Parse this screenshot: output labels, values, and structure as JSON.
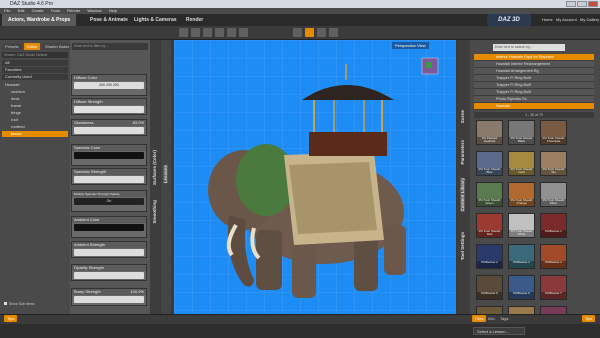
{
  "window": {
    "title": "DAZ Studio 4.6 Pro"
  },
  "menu": [
    "File",
    "Edit",
    "Create",
    "Tools",
    "Render",
    "Window",
    "Help"
  ],
  "main_tabs": [
    {
      "label": "Actors, Wardrobe & Props",
      "active": true
    },
    {
      "label": "Pose & Animate",
      "active": false
    },
    {
      "label": "Lights & Cameras",
      "active": false
    },
    {
      "label": "Render",
      "active": false
    }
  ],
  "brand": {
    "logo": "DAZ 3D"
  },
  "account_links": [
    "Home",
    "My Account",
    "My Gallery"
  ],
  "left_panel": {
    "tabs": [
      {
        "label": "Presets",
        "active": false
      },
      {
        "label": "Editor",
        "active": true
      },
      {
        "label": "Shader Baker",
        "active": false
      }
    ],
    "filter_placeholder": "Enter text to filter by...",
    "tree": [
      {
        "label": "All",
        "type": "hdr",
        "selected": false
      },
      {
        "label": "Favorites",
        "type": "hdr",
        "selected": false
      },
      {
        "label": "Currently Used",
        "type": "hdr",
        "selected": false
      },
      {
        "label": "Howdah",
        "type": "item",
        "selected": false
      },
      {
        "label": "cushion",
        "type": "item",
        "selected": false
      },
      {
        "label": "deck",
        "type": "item",
        "selected": false
      },
      {
        "label": "frame",
        "type": "item",
        "selected": false
      },
      {
        "label": "fringe",
        "type": "item",
        "selected": false
      },
      {
        "label": "roof",
        "type": "item",
        "selected": false
      },
      {
        "label": "roofend",
        "type": "item",
        "selected": false
      },
      {
        "label": "tassel",
        "type": "item",
        "selected": true
      }
    ],
    "show_sub_items": "Show Sub Items",
    "tips_button": "Tips"
  },
  "surface_props": [
    {
      "label": "Diffuse Color",
      "value": "200 200 200"
    },
    {
      "label": "Diffuse Strength",
      "value": ""
    },
    {
      "label": "Glossiness",
      "value": "83.0%"
    },
    {
      "label": "Specular Color",
      "value": ""
    },
    {
      "label": "Specular Strength",
      "value": ""
    },
    {
      "label": "Multiply Specular Through Opacity",
      "value": "On"
    },
    {
      "label": "Ambient Color",
      "value": ""
    },
    {
      "label": "Ambient Strength",
      "value": ""
    },
    {
      "label": "Opacity Strength",
      "value": ""
    },
    {
      "label": "Bump Strength",
      "value": "100.0%"
    }
  ],
  "side_vtabs": [
    "Surfaces (Color)",
    "Smoothing"
  ],
  "side_vtabs2": [
    "Lessons"
  ],
  "viewport": {
    "view_label": "Perspective View"
  },
  "right_vtabs": [
    "Scene",
    "Parameters",
    "Content Library",
    "Tool Settings"
  ],
  "right_panel": {
    "search_placeholder": "Enter text to search by...",
    "scene_rows": [
      {
        "label": "Interior Howdah Grpd for Elephant",
        "selected": true
      },
      {
        "label": "Howdah Interior Rearrangement",
        "selected": false
      },
      {
        "label": "Howdah Arrangement Rg",
        "selected": false
      },
      {
        "label": "Trapper FI Ring Built",
        "selected": false
      },
      {
        "label": "Trapper FI Ring Built",
        "selected": false
      },
      {
        "label": "Trapper FI Ring Built",
        "selected": false
      },
      {
        "label": "Photo Rlphotto Rx",
        "selected": false
      },
      {
        "label": "Howdah",
        "selected": true
      }
    ],
    "pager": "1 - 30 of 70",
    "thumbs": [
      {
        "label": "PH Painted elephant",
        "color": "#8a7a6a"
      },
      {
        "label": "PH Tusk Sheath Black",
        "color": "#777"
      },
      {
        "label": "PH Tusk Sheath Chocolate",
        "color": "#7a5a40"
      },
      {
        "label": "PH Tusk Sheath Blue",
        "color": "#5a6a8a"
      },
      {
        "label": "PH Tusk Sheath Gold",
        "color": "#a58a40"
      },
      {
        "label": "PH Tusk Sheath Tan",
        "color": "#9a8060"
      },
      {
        "label": "PH Tusk Sheath Green",
        "color": "#5a7a50"
      },
      {
        "label": "PH Tusk Sheath Orange",
        "color": "#b06a30"
      },
      {
        "label": "PH Tusk Sheath Silver",
        "color": "#909090"
      },
      {
        "label": "PH Tusk Sheath Red",
        "color": "#9a3a30"
      },
      {
        "label": "PH Tusk Sheath White",
        "color": "#c0c0c0"
      },
      {
        "label": "PHBlanket 1",
        "color": "#7a2a2a"
      },
      {
        "label": "PHBlanket 2",
        "color": "#2a3a6a"
      },
      {
        "label": "PHBlanket 3",
        "color": "#3a6a7a"
      },
      {
        "label": "PHBlanket 4",
        "color": "#a04a2a"
      },
      {
        "label": "PHBlanket 5",
        "color": "#5a4a3a"
      },
      {
        "label": "PHBlanket 6",
        "color": "#3a5a8a"
      },
      {
        "label": "PHBlanket 7",
        "color": "#8a3a3a"
      },
      {
        "label": "PHBlanket 8",
        "color": "#6a5a3a"
      },
      {
        "label": "PHBlanket 9",
        "color": "#9a7a4a"
      },
      {
        "label": "PHBlanket 10",
        "color": "#7a3a5a"
      }
    ],
    "bottom_tabs": [
      "Files",
      "Info",
      "Tags"
    ],
    "tips_button": "Tips"
  },
  "status": {
    "lesson_select": "Select a Lesson..."
  }
}
